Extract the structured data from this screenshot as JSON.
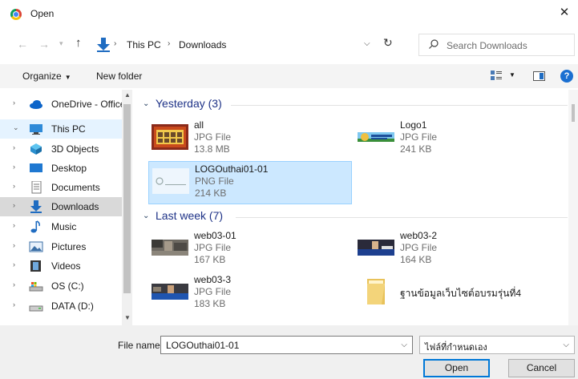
{
  "window": {
    "title": "Open"
  },
  "address": {
    "crumbs": [
      "This PC",
      "Downloads"
    ]
  },
  "search": {
    "placeholder": "Search Downloads"
  },
  "toolbar": {
    "organize": "Organize",
    "new_folder": "New folder"
  },
  "nav": {
    "items": [
      {
        "label": "OneDrive - Office",
        "icon": "cloud-icon",
        "chevron": "collapsed"
      },
      {
        "label": "This PC",
        "icon": "computer-icon",
        "chevron": "expanded"
      },
      {
        "label": "3D Objects",
        "icon": "3d-objects-icon",
        "chevron": "collapsed"
      },
      {
        "label": "Desktop",
        "icon": "desktop-icon",
        "chevron": "collapsed"
      },
      {
        "label": "Documents",
        "icon": "documents-icon",
        "chevron": "collapsed"
      },
      {
        "label": "Downloads",
        "icon": "downloads-icon",
        "chevron": "collapsed",
        "selected": true
      },
      {
        "label": "Music",
        "icon": "music-icon",
        "chevron": "collapsed"
      },
      {
        "label": "Pictures",
        "icon": "pictures-icon",
        "chevron": "collapsed"
      },
      {
        "label": "Videos",
        "icon": "videos-icon",
        "chevron": "collapsed"
      },
      {
        "label": "OS (C:)",
        "icon": "os-drive-icon",
        "chevron": "collapsed"
      },
      {
        "label": "DATA (D:)",
        "icon": "data-drive-icon",
        "chevron": "collapsed"
      }
    ]
  },
  "groups": [
    {
      "title": "Yesterday (3)",
      "files": [
        {
          "name": "all",
          "type": "JPG File",
          "size": "13.8 MB"
        },
        {
          "name": "Logo1",
          "type": "JPG File",
          "size": "241 KB"
        },
        {
          "name": "LOGOuthai01-01",
          "type": "PNG File",
          "size": "214 KB",
          "selected": true
        }
      ]
    },
    {
      "title": "Last week (7)",
      "files": [
        {
          "name": "web03-01",
          "type": "JPG File",
          "size": "167 KB"
        },
        {
          "name": "web03-2",
          "type": "JPG File",
          "size": "164 KB"
        },
        {
          "name": "web03-3",
          "type": "JPG File",
          "size": "183 KB"
        },
        {
          "name": "ฐานข้อมูลเว็บไซต์อบรมรุ่นที่4",
          "type": "",
          "size": ""
        }
      ]
    }
  ],
  "footer": {
    "file_name_label": "File name:",
    "file_name_value": "LOGOuthai01-01",
    "file_type_value": "ไฟล์ที่กำหนดเอง",
    "open": "Open",
    "cancel": "Cancel"
  },
  "colors": {
    "accent": "#0078d7",
    "selection": "#cce8ff",
    "group_title": "#1e3287"
  }
}
